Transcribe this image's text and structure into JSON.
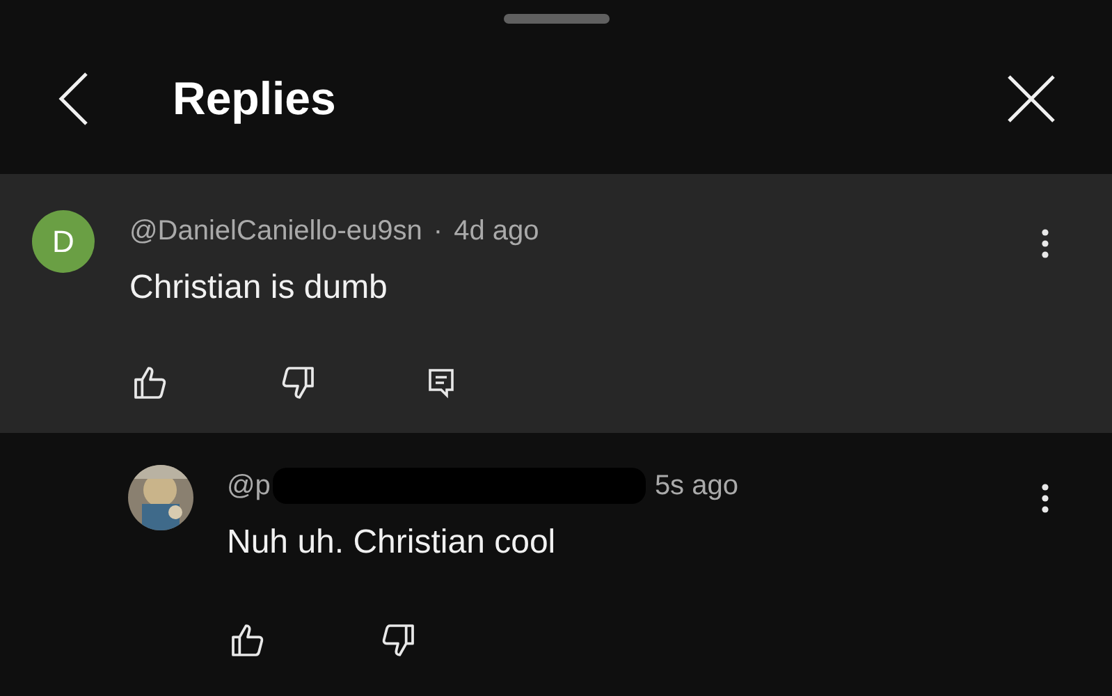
{
  "header": {
    "title": "Replies"
  },
  "comment": {
    "avatar": {
      "kind": "letter",
      "letter": "D",
      "color": "#6a9f44"
    },
    "author": "@DanielCaniello-eu9sn",
    "separator": "·",
    "time": "4d ago",
    "text": "Christian is dumb"
  },
  "reply": {
    "author": "@p",
    "time": "5s ago",
    "text": "Nuh uh. Christian cool"
  }
}
